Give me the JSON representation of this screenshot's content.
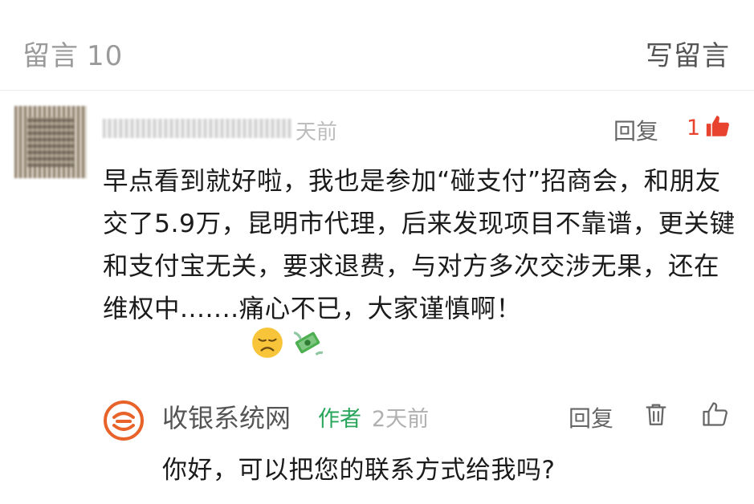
{
  "header": {
    "section_label": "留言",
    "count": "10",
    "write_label": "写留言"
  },
  "comment": {
    "time": "天前",
    "reply_label": "回复",
    "like_count": "1",
    "text": "早点看到就好啦，我也是参加“碰支付”招商会，和朋友交了5.9万，昆明市代理，后来发现项目不靠谱，更关键和支付宝无关，要求退费，与对方多次交涉无果，还在维权中.......痛心不已，大家谨慎啊！",
    "emojis": [
      "disappointed-face",
      "money-with-wings"
    ]
  },
  "reply": {
    "name": "收银系统网",
    "author_tag": "作者",
    "time": "2天前",
    "reply_label": "回复",
    "text": "你好，可以把您的联系方式给我吗?"
  },
  "colors": {
    "like_accent": "#e8432e",
    "author_tag": "#27a55b",
    "logo": "#e8632a"
  }
}
